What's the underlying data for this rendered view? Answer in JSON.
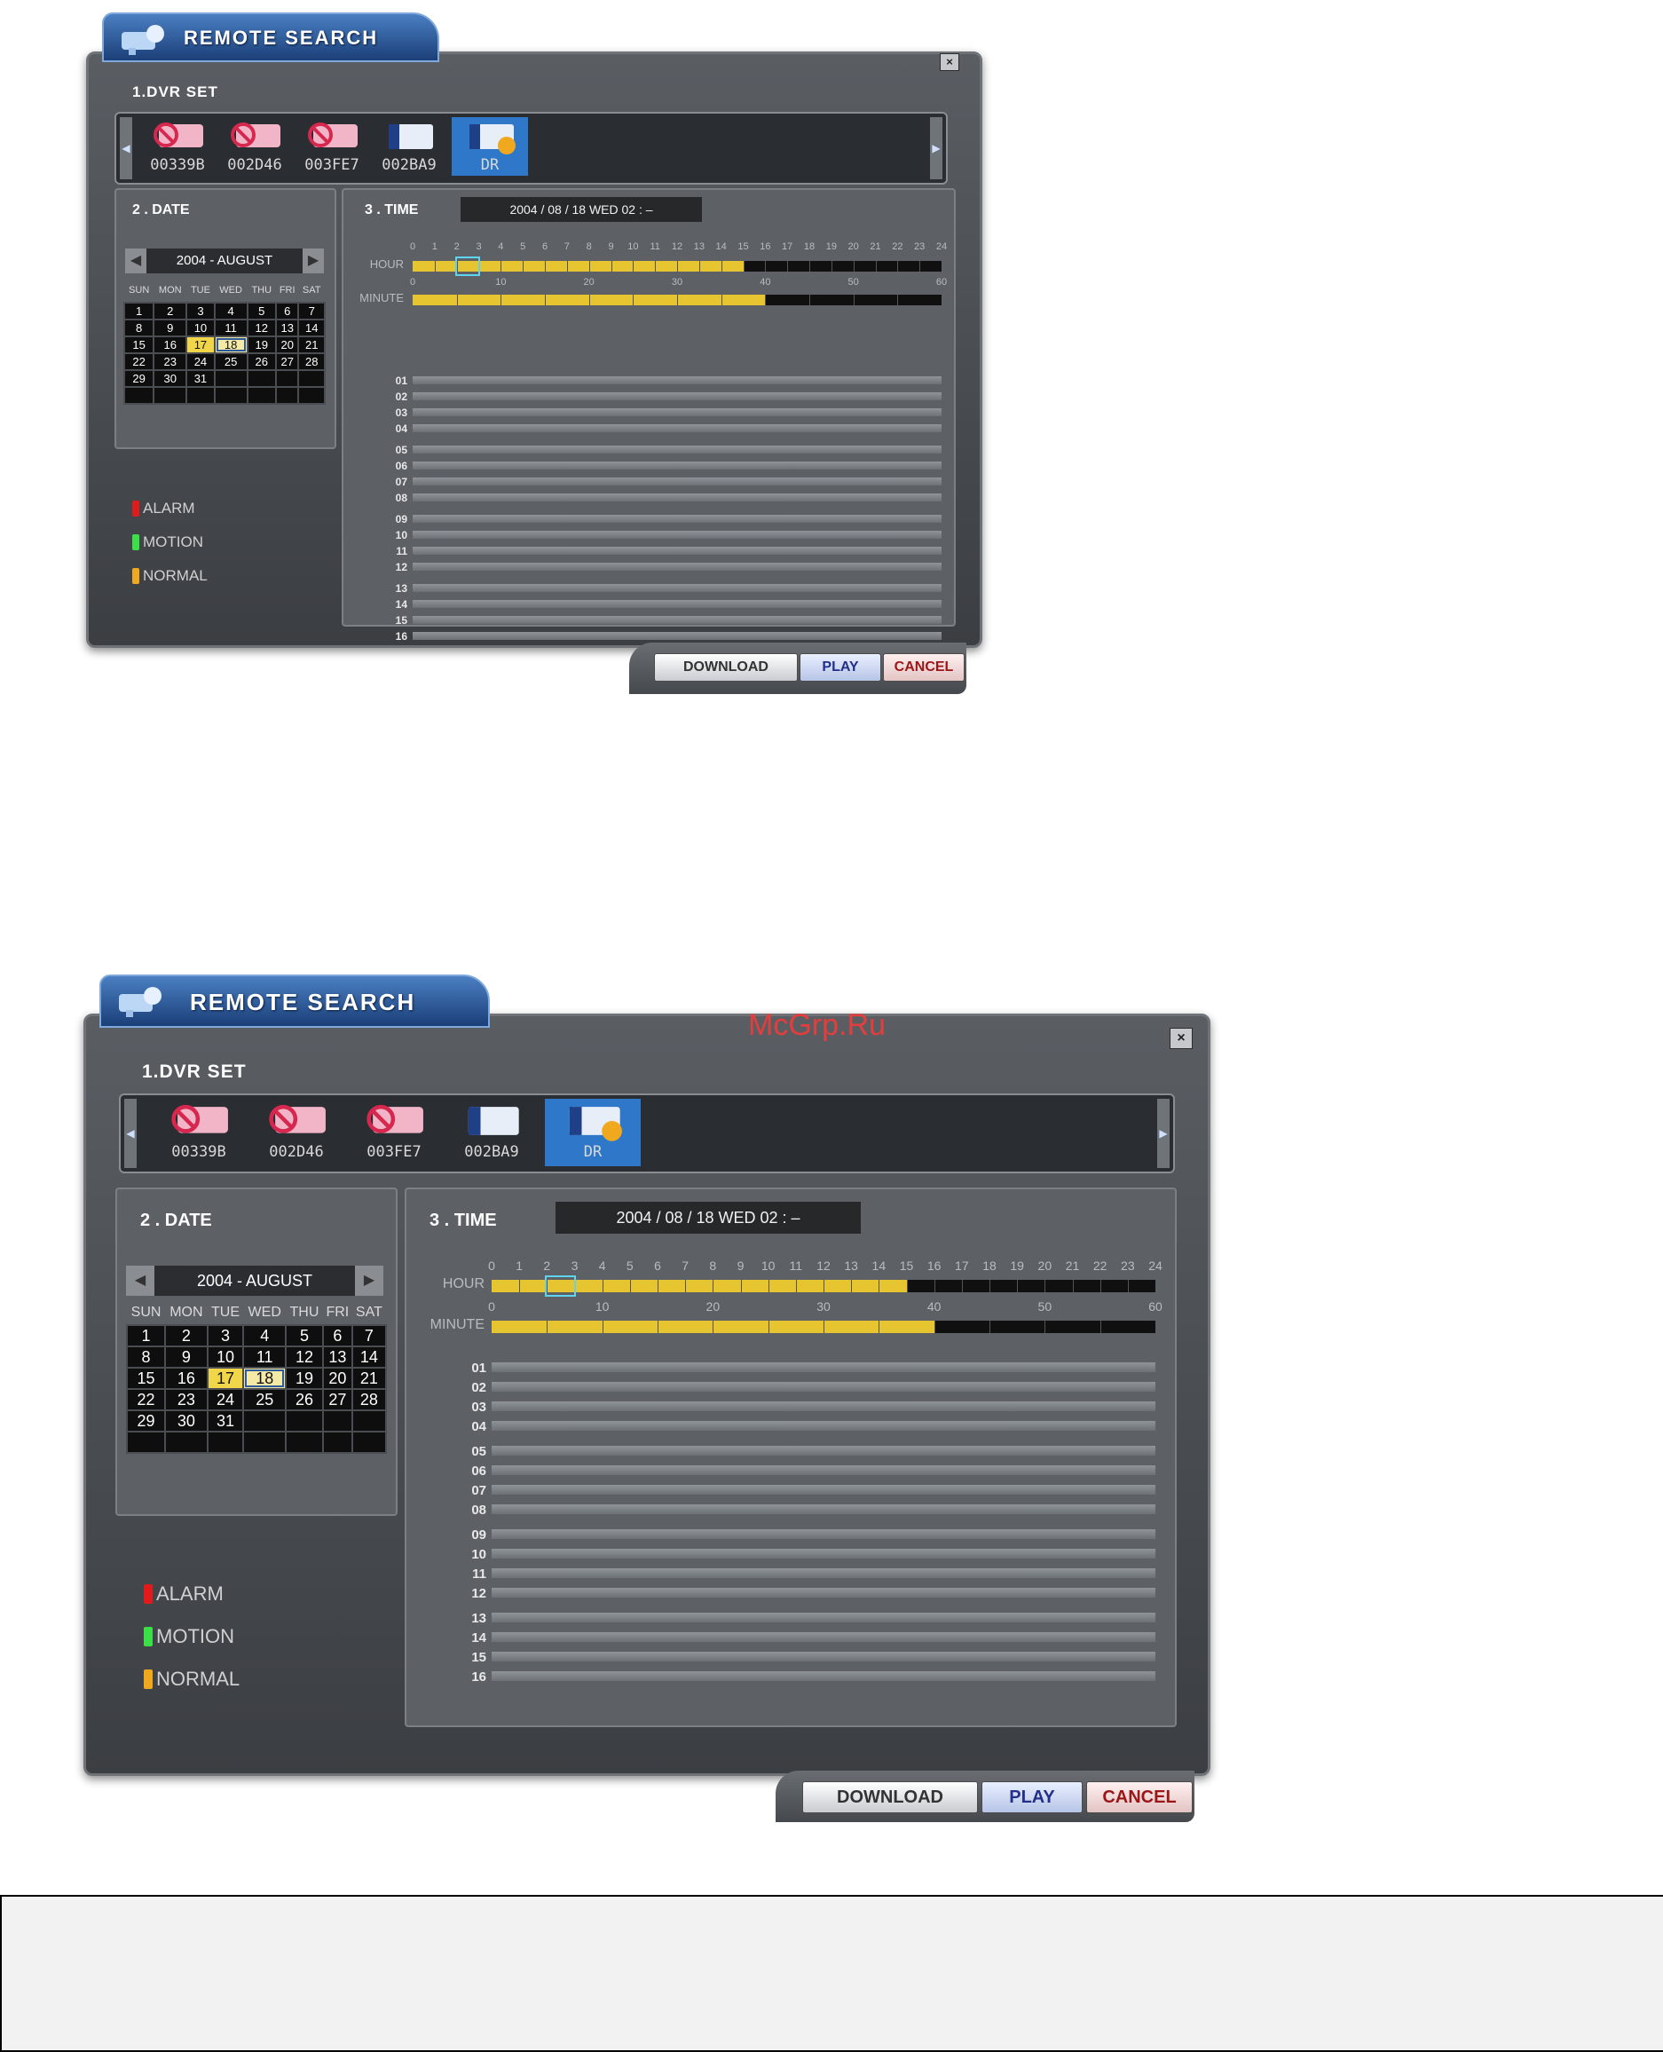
{
  "window": {
    "title": "REMOTE SEARCH",
    "close_label": "×"
  },
  "dvr_set": {
    "label": "1.DVR SET",
    "items": [
      {
        "label": "00339B",
        "status": "offline",
        "icon": "camera-offline-icon"
      },
      {
        "label": "002D46",
        "status": "offline",
        "icon": "camera-offline-icon"
      },
      {
        "label": "003FE7",
        "status": "offline",
        "icon": "camera-offline-icon"
      },
      {
        "label": "002BA9",
        "status": "online",
        "icon": "dvr-icon"
      },
      {
        "label": "DR",
        "status": "selected",
        "icon": "dvr-active-icon"
      }
    ],
    "prev_icon": "chevron-left-icon",
    "next_icon": "chevron-right-icon"
  },
  "date": {
    "label": "2 . DATE",
    "month": "2004 - AUGUST",
    "weekdays": [
      "SUN",
      "MON",
      "TUE",
      "WED",
      "THU",
      "FRI",
      "SAT"
    ],
    "weeks": [
      [
        "1",
        "2",
        "3",
        "4",
        "5",
        "6",
        "7"
      ],
      [
        "8",
        "9",
        "10",
        "11",
        "12",
        "13",
        "14"
      ],
      [
        "15",
        "16",
        "17",
        "18",
        "19",
        "20",
        "21"
      ],
      [
        "22",
        "23",
        "24",
        "25",
        "26",
        "27",
        "28"
      ],
      [
        "29",
        "30",
        "31",
        "",
        "",
        "",
        ""
      ],
      [
        "",
        "",
        "",
        "",
        "",
        "",
        ""
      ]
    ],
    "highlighted_day": "17",
    "selected_day": "18"
  },
  "legend": [
    {
      "label": "ALARM",
      "color": "#e11b1b"
    },
    {
      "label": "MOTION",
      "color": "#3be046"
    },
    {
      "label": "NORMAL",
      "color": "#f0a81e"
    }
  ],
  "time": {
    "label": "3 . TIME",
    "display": "2004 / 08 / 18 WED 02 : –",
    "hour_label": "HOUR",
    "minute_label": "MINUTE",
    "hour_ticks": [
      "0",
      "1",
      "2",
      "3",
      "4",
      "5",
      "6",
      "7",
      "8",
      "9",
      "10",
      "11",
      "12",
      "13",
      "14",
      "15",
      "16",
      "17",
      "18",
      "19",
      "20",
      "21",
      "22",
      "23",
      "24"
    ],
    "minute_ticks": [
      "0",
      "10",
      "20",
      "30",
      "40",
      "50",
      "60"
    ],
    "hour_recorded_until": 15,
    "selected_hour": 2,
    "minute_recorded_until": 40,
    "channels": [
      "01",
      "02",
      "03",
      "04",
      "05",
      "06",
      "07",
      "08",
      "09",
      "10",
      "11",
      "12",
      "13",
      "14",
      "15",
      "16"
    ]
  },
  "buttons": {
    "download": "DOWNLOAD",
    "play": "PLAY",
    "cancel": "CANCEL"
  },
  "watermark": "McGrp.Ru"
}
